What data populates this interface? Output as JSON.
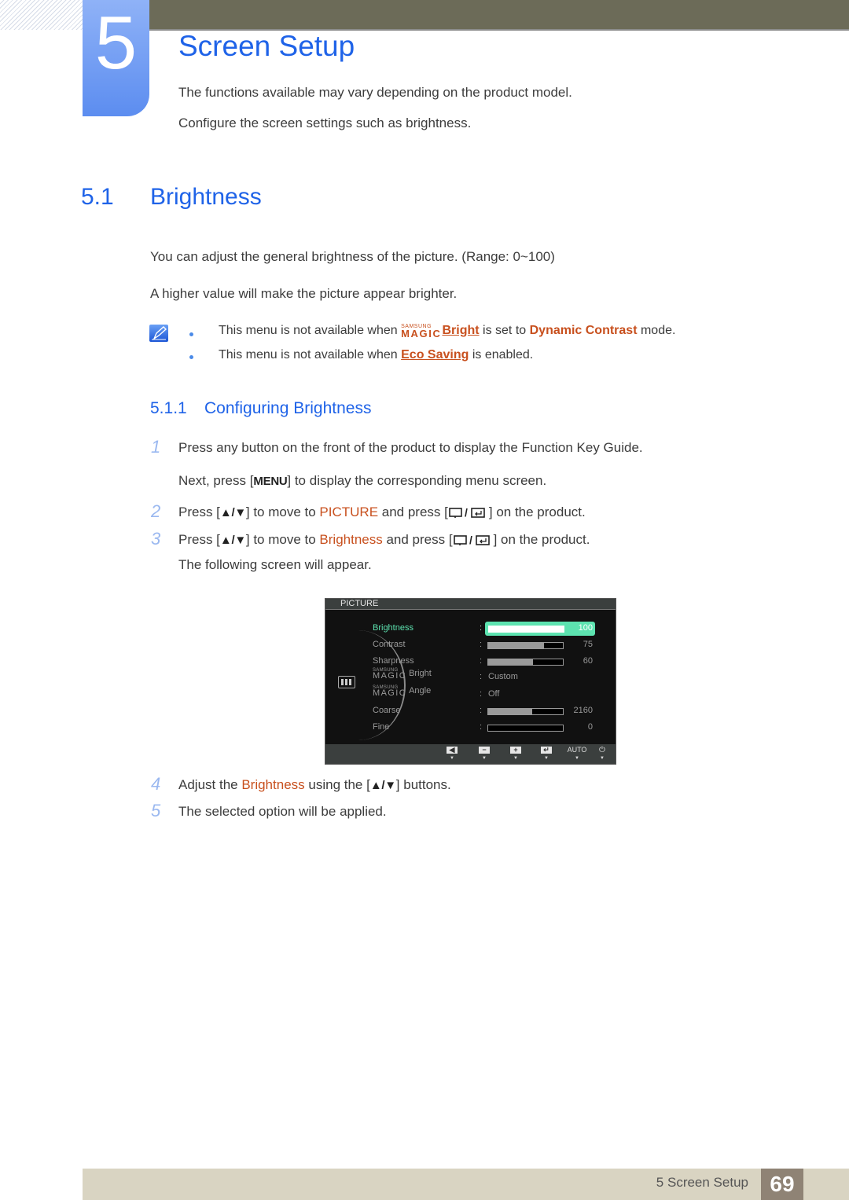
{
  "header": {
    "chapter_number": "5",
    "chapter_title": "Screen Setup",
    "intro": [
      "The functions available may vary depending on the product model.",
      "Configure the screen settings such as brightness."
    ]
  },
  "section": {
    "number": "5.1",
    "title": "Brightness",
    "paragraphs": [
      "You can adjust the general brightness of the picture. (Range: 0~100)",
      "A higher value will make the picture appear brighter."
    ],
    "notes": [
      {
        "prefix": "This menu is not available when ",
        "magic_small": "SAMSUNG",
        "magic_big": "MAGIC",
        "link": "Bright",
        "middle": " is set to ",
        "highlight": "Dynamic Contrast",
        "suffix": " mode."
      },
      {
        "prefix": "This menu is not available when ",
        "link": "Eco Saving",
        "suffix": " is enabled."
      }
    ]
  },
  "subsection": {
    "number": "5.1.1",
    "title": "Configuring Brightness",
    "steps": [
      {
        "num": "1",
        "text": "Press any button on the front of the product to display the Function Key Guide."
      },
      {
        "num": "",
        "pre": "Next, press [",
        "key": "MENU",
        "post": "] to display the corresponding menu screen."
      },
      {
        "num": "2",
        "pre": "Press [",
        "arrows": "▲/▼",
        "mid": "] to move to ",
        "hl": "PICTURE",
        "mid2": " and press [",
        "post": "] on the product."
      },
      {
        "num": "3",
        "pre": "Press [",
        "arrows": "▲/▼",
        "mid": "] to move to ",
        "hl": "Brightness",
        "mid2": " and press [",
        "post": "] on the product."
      },
      {
        "num": "",
        "text": "The following screen will appear."
      },
      {
        "num": "4",
        "pre": "Adjust the ",
        "hl": "Brightness",
        "mid": " using the [",
        "arrows": "▲/▼",
        "post": "] buttons."
      },
      {
        "num": "5",
        "text": "The selected option will be applied."
      }
    ]
  },
  "osd": {
    "title": "PICTURE",
    "rows": [
      {
        "label": "Brightness",
        "type": "bar",
        "value": "100",
        "fraction": 1.0,
        "selected": true
      },
      {
        "label": "Contrast",
        "type": "bar",
        "value": "75",
        "fraction": 0.75
      },
      {
        "label": "Sharpness",
        "type": "bar",
        "value": "60",
        "fraction": 0.6
      },
      {
        "label": "Bright",
        "magic": true,
        "type": "text",
        "value": "Custom"
      },
      {
        "label": "Angle",
        "magic": true,
        "type": "text",
        "value": "Off"
      },
      {
        "label": "Coarse",
        "type": "bar",
        "value": "2160",
        "fraction": 0.59
      },
      {
        "label": "Fine",
        "type": "bar",
        "value": "0",
        "fraction": 0.0
      }
    ],
    "magic_small": "SAMSUNG",
    "magic_big": "MAGIC",
    "buttons": [
      {
        "name": "left",
        "glyph": "◀"
      },
      {
        "name": "minus",
        "glyph": "−"
      },
      {
        "name": "plus",
        "glyph": "+"
      },
      {
        "name": "enter",
        "glyph": "↵"
      },
      {
        "name": "auto",
        "label": "AUTO"
      },
      {
        "name": "power",
        "glyph": "⏻"
      }
    ]
  },
  "footer": {
    "section_label": "5 Screen Setup",
    "page_number": "69"
  },
  "colors": {
    "heading_blue": "#1f63e8",
    "highlight_orange": "#c8501e",
    "osd_selected": "#5de3b0",
    "topbar": "#6c6b58",
    "footer_bg": "#d9d4c2",
    "page_badge": "#8f8375"
  }
}
